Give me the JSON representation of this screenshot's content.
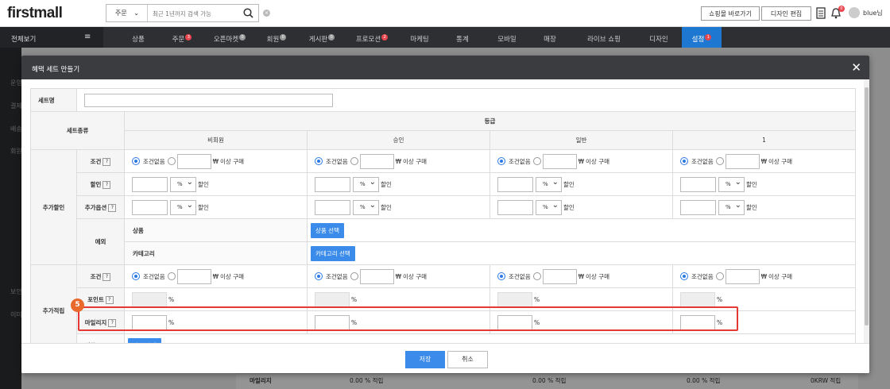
{
  "topbar": {
    "logo": "firstmall",
    "search_select": "주문",
    "search_placeholder": "최근 1년까지 검색 가능",
    "btn_shop": "쇼핑몰 바로가기",
    "btn_design": "디자인 편집",
    "notif_count": "0",
    "user": "blue님"
  },
  "nav": {
    "all": "전체보기",
    "items": [
      {
        "label": "상품"
      },
      {
        "label": "주문",
        "badge": "3",
        "badge_color": "#e8464f"
      },
      {
        "label": "오픈마켓",
        "badge": "0"
      },
      {
        "label": "회원",
        "badge": "0"
      },
      {
        "label": "게시판",
        "badge": "0"
      },
      {
        "label": "프로모션",
        "badge": "2",
        "badge_color": "#e8464f"
      },
      {
        "label": "마케팅"
      },
      {
        "label": "통계"
      },
      {
        "label": "모바일"
      },
      {
        "label": "매장"
      },
      {
        "label": "라이브 쇼핑"
      },
      {
        "label": "디자인"
      },
      {
        "label": "설정",
        "badge": "1",
        "badge_color": "#e8464f"
      }
    ]
  },
  "sidebar": {
    "items": [
      "운영",
      "결제",
      "배송",
      "회원",
      "보안",
      "이미"
    ]
  },
  "modal": {
    "title": "혜택 세트 만들기",
    "set_name_label": "세트명",
    "set_type_label": "세트종류",
    "grade_label": "등급",
    "grades": [
      "비회원",
      "승인",
      "일반",
      "1"
    ],
    "extra_discount_label": "추가할인",
    "extra_reward_label": "추가적립",
    "condition_label": "조건",
    "discount_label": "할인",
    "option_label": "추가옵션",
    "exception_label": "예외",
    "product_label": "상품",
    "category_label": "카테고리",
    "product_select_btn": "상품 선택",
    "category_select_btn": "카테고리 선택",
    "point_label": "포인트",
    "mileage_label": "마일리지",
    "no_condition": "조건없음",
    "currency": "₩",
    "above_purchase": "이상 구매",
    "unit_select": "%",
    "discount_suffix": "할인",
    "percent": "%",
    "save_btn": "저장",
    "cancel_btn": "취소"
  },
  "background_row": {
    "label": "마일리지",
    "values": [
      "0.00 % 적립",
      "0.00 % 적립",
      "0.00 % 적립",
      "0KRW 적립"
    ]
  },
  "step_badge": "5",
  "colors": {
    "accent": "#3b8bea",
    "highlight": "#e53935",
    "step": "#e8692b",
    "nav_bg": "#2d2f33",
    "settings_tab": "#1e78d2"
  }
}
